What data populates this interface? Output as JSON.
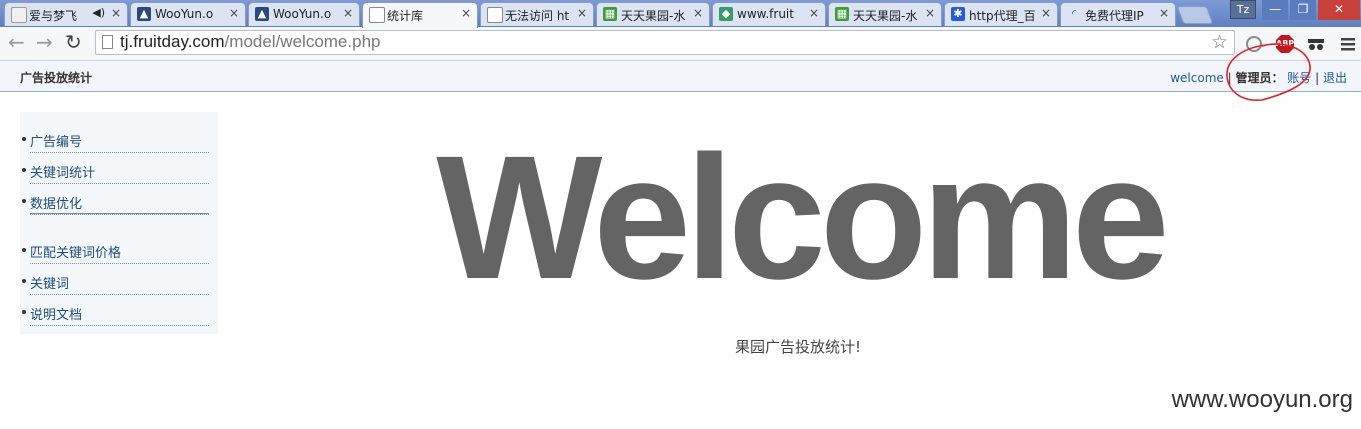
{
  "browser": {
    "tabs": [
      {
        "title": "爱与梦飞",
        "icon": "page-icon",
        "close": "×"
      },
      {
        "title": "WooYun.o",
        "icon": "wooyun-icon",
        "close": "×"
      },
      {
        "title": "WooYun.o",
        "icon": "wooyun-icon",
        "close": "×"
      },
      {
        "title": "统计库",
        "icon": "page-icon",
        "close": "×"
      },
      {
        "title": "无法访问 ht",
        "icon": "page-icon",
        "close": "×"
      },
      {
        "title": "天天果园-水",
        "icon": "fruitday-icon",
        "close": "×"
      },
      {
        "title": "www.fruit",
        "icon": "fruitday-icon",
        "close": "×"
      },
      {
        "title": "天天果园-水",
        "icon": "fruitday-icon",
        "close": "×"
      },
      {
        "title": "http代理_百",
        "icon": "paw-icon",
        "close": "×"
      },
      {
        "title": "免费代理IP",
        "icon": "loading-icon",
        "close": "×"
      }
    ],
    "profile_badge": "Tz",
    "window_controls": {
      "minimize": "—",
      "maximize": "❐",
      "close": "✕"
    },
    "url": {
      "host": "tj.fruitday.com",
      "path": "/model/welcome.php"
    },
    "extensions": {
      "abp": "ABP"
    }
  },
  "app": {
    "title": "广告投放统计",
    "user": {
      "welcome": "welcome",
      "sep1": " | ",
      "role": "管理员：",
      "account": "账号",
      "sep2": " | ",
      "logout": "退出"
    }
  },
  "sidebar": {
    "items": [
      {
        "label": "广告编号"
      },
      {
        "label": "关键词统计"
      },
      {
        "label": "数据优化"
      },
      {
        "label": "匹配关键词价格"
      },
      {
        "label": "关键词"
      },
      {
        "label": "说明文档"
      }
    ]
  },
  "main": {
    "heading": "Welcome",
    "subtitle": "果园广告投放统计!"
  },
  "watermark": "www.wooyun.org",
  "colors": {
    "annotation": "#e0202a",
    "link": "#1f5a96",
    "heading": "#646464"
  }
}
